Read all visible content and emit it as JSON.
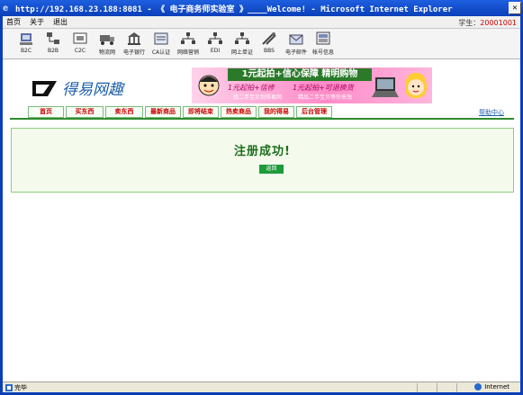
{
  "window": {
    "title": "http://192.168.23.188:8081 - 《 电子商务师实验室 》____Welcome! - Microsoft Internet Explorer"
  },
  "menubar": {
    "items": [
      "首页",
      "关于",
      "退出"
    ],
    "status_prefix": "学生：",
    "status_value": "20001001"
  },
  "toolbar": {
    "buttons": [
      {
        "label": "B2C",
        "icon": "b2c-icon"
      },
      {
        "label": "B2B",
        "icon": "b2b-icon"
      },
      {
        "label": "C2C",
        "icon": "c2c-icon"
      },
      {
        "label": "物流网",
        "icon": "logistics-icon"
      },
      {
        "label": "电子银行",
        "icon": "bank-icon"
      },
      {
        "label": "CA认证",
        "icon": "ca-icon"
      },
      {
        "label": "网络营销",
        "icon": "marketing-icon"
      },
      {
        "label": "EDI",
        "icon": "edi-icon"
      },
      {
        "label": "网上单证",
        "icon": "documents-icon"
      },
      {
        "label": "BBS",
        "icon": "bbs-icon"
      },
      {
        "label": "电子邮件",
        "icon": "email-icon"
      },
      {
        "label": "帐号信息",
        "icon": "account-icon"
      }
    ]
  },
  "site": {
    "logo_text": "得易网趣",
    "banner": {
      "headline": "1元起拍+信心保障 精明购物",
      "left_line1": "1元起拍+信修",
      "left_line2": "找二手宝贝到得易网",
      "right_line1": "1元起拍+可退换货",
      "right_line2": "精品二手宝贝等你来淘"
    },
    "nav": [
      {
        "label": "首页",
        "width": 40
      },
      {
        "label": "买东西",
        "width": 42
      },
      {
        "label": "卖东西",
        "width": 42
      },
      {
        "label": "最新商品",
        "width": 40
      },
      {
        "label": "即将结束",
        "width": 40
      },
      {
        "label": "热卖商品",
        "width": 40
      },
      {
        "label": "我的得易",
        "width": 40
      },
      {
        "label": "后台管理",
        "width": 40
      }
    ],
    "help_link": "帮助中心",
    "message": "注册成功!",
    "back_button": "返回"
  },
  "statusbar": {
    "text": "完毕",
    "zone": "Internet"
  },
  "colors": {
    "titlebar": "#0a3fb8",
    "nav_text": "#cc0000",
    "nav_line": "#2e8b2e",
    "message": "#1c6e1c",
    "button": "#1d9a3a"
  }
}
